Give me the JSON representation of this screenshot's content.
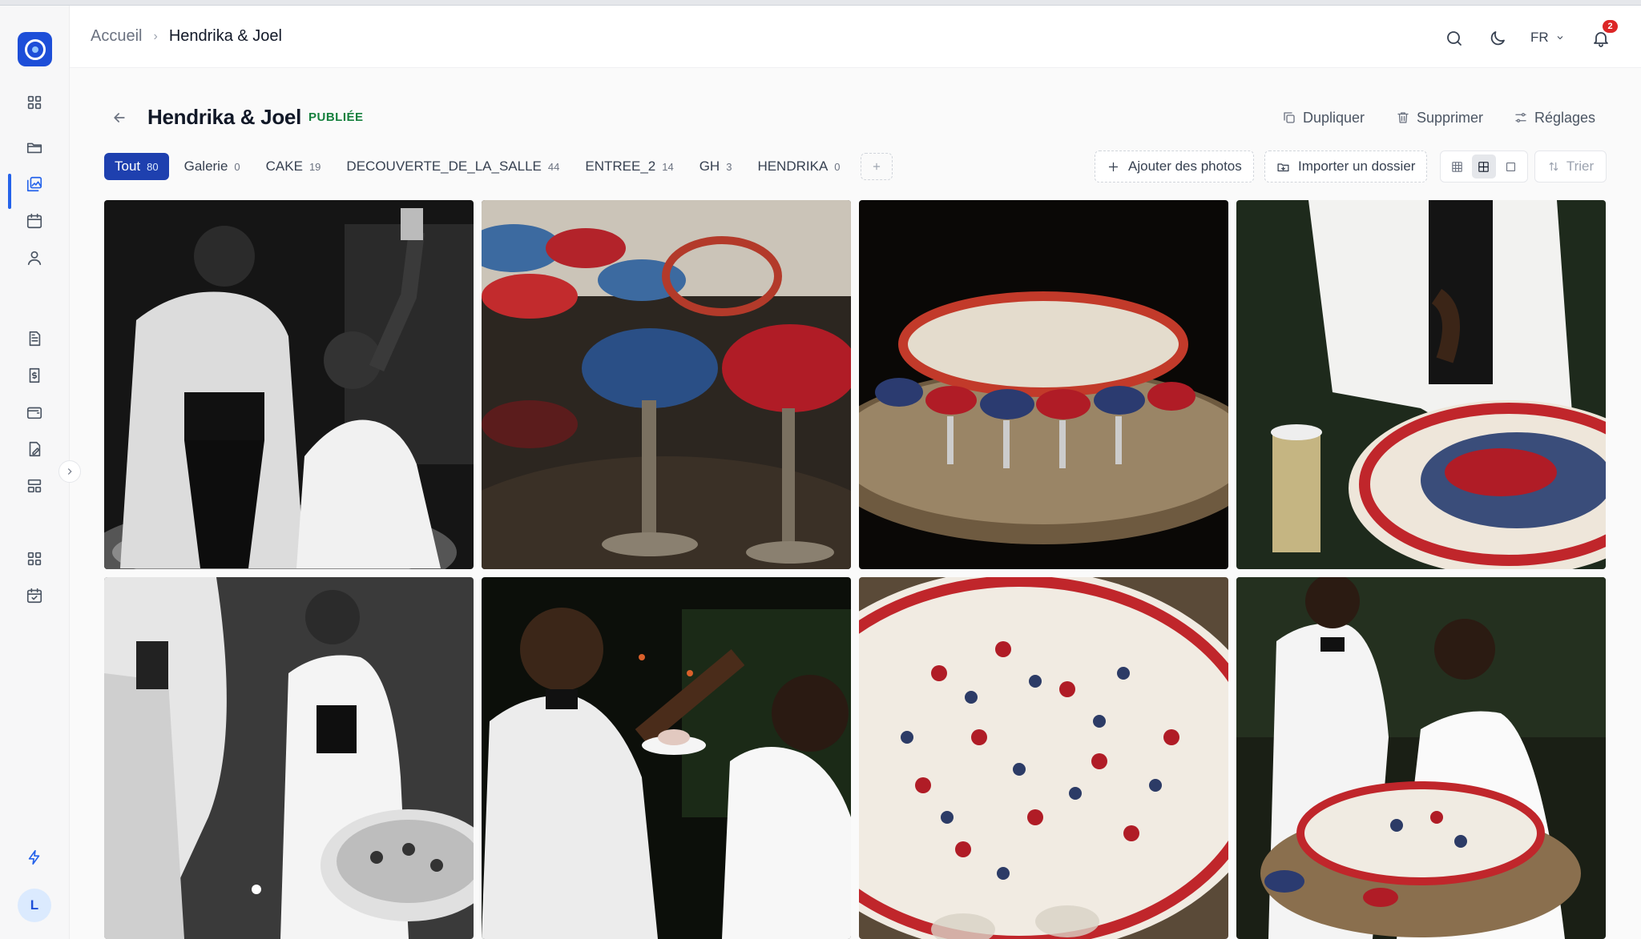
{
  "breadcrumb": {
    "home": "Accueil",
    "separator": "›",
    "current": "Hendrika & Joel"
  },
  "header": {
    "language": "FR",
    "notifications_count": "2"
  },
  "sidebar": {
    "icons": [
      "dashboard-icon",
      "folder-icon",
      "galleries-icon",
      "calendar-icon",
      "user-icon",
      "document-icon",
      "invoice-icon",
      "wallet-icon",
      "contract-icon",
      "layout-icon",
      "apps-icon",
      "calendar-check-icon",
      "bolt-icon"
    ],
    "avatar_initial": "L"
  },
  "gallery": {
    "title": "Hendrika & Joel",
    "status": "PUBLIÉE",
    "actions": {
      "duplicate": "Dupliquer",
      "delete": "Supprimer",
      "settings": "Réglages"
    }
  },
  "tabs": [
    {
      "label": "Tout",
      "count": "80",
      "active": true
    },
    {
      "label": "Galerie",
      "count": "0"
    },
    {
      "label": "CAKE",
      "count": "19"
    },
    {
      "label": "DECOUVERTE_DE_LA_SALLE",
      "count": "44"
    },
    {
      "label": "ENTREE_2",
      "count": "14"
    },
    {
      "label": "GH",
      "count": "3"
    },
    {
      "label": "HENDRIKA",
      "count": "0"
    }
  ],
  "toolbar": {
    "add_photos": "Ajouter des photos",
    "import_folder": "Importer un dossier",
    "sort": "Trier"
  },
  "photos": [
    {
      "scene": "bw-couple-toast"
    },
    {
      "scene": "berries-glasses"
    },
    {
      "scene": "cake-table-dark"
    },
    {
      "scene": "cake-with-champagne"
    },
    {
      "scene": "bw-guests-cake"
    },
    {
      "scene": "groom-fed-cake"
    },
    {
      "scene": "cake-closeup"
    },
    {
      "scene": "couple-serving-cake"
    }
  ],
  "colors": {
    "accent": "#1e40af",
    "status_green": "#15803d",
    "badge_red": "#dc2626"
  }
}
